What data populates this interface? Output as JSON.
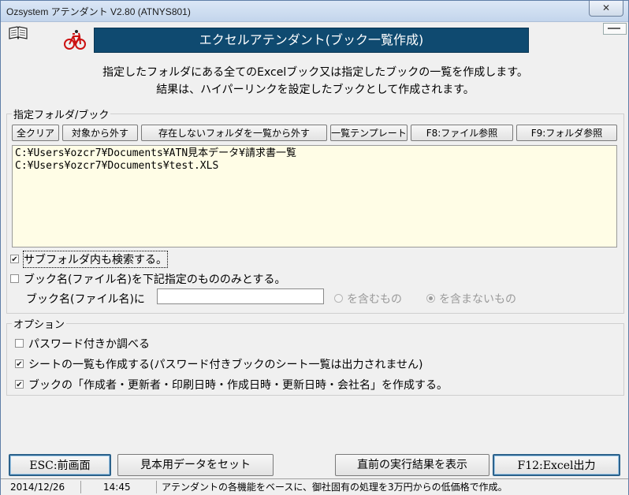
{
  "window": {
    "title": "Ozsystem アテンダント V2.80 (ATNYS801)",
    "close_glyph": "✕"
  },
  "header": {
    "banner": "エクセルアテンダント(ブック一覧作成)",
    "desc_line1": "指定したフォルダにある全てのExcelブック又は指定したブックの一覧を作成します。",
    "desc_line2": "結果は、ハイパーリンクを設定したブックとして作成されます。"
  },
  "folder_group": {
    "label": "指定フォルダ/ブック",
    "buttons": {
      "clear_all": "全クリア",
      "exclude": "対象から外す",
      "remove_missing": "存在しないフォルダを一覧から外す",
      "template": "一覧テンプレート",
      "file_ref": "F8:ファイル参照",
      "folder_ref": "F9:フォルダ参照"
    },
    "paths": [
      "C:¥Users¥ozcr7¥Documents¥ATN見本データ¥請求書一覧",
      "C:¥Users¥ozcr7¥Documents¥test.XLS"
    ],
    "subfolder_label": "サブフォルダ内も検索する。",
    "subfolder_checked": true,
    "bookname_only_label": "ブック名(ファイル名)を下記指定のもののみとする。",
    "bookname_only_checked": false,
    "bookname_field_label": "ブック名(ファイル名)に",
    "bookname_value": "",
    "radio_include": "を含むもの",
    "radio_exclude": "を含まないもの",
    "radio_selected": "exclude"
  },
  "options": {
    "label": "オプション",
    "items": [
      {
        "label": "パスワード付きか調べる",
        "checked": false
      },
      {
        "label": "シートの一覧も作成する(パスワード付きブックのシート一覧は出力されません)",
        "checked": true
      },
      {
        "label": "ブックの「作成者・更新者・印刷日時・作成日時・更新日時・会社名」を作成する。",
        "checked": true
      }
    ]
  },
  "footer_buttons": {
    "esc": "ESC:前画面",
    "sample": "見本用データをセット",
    "last_result": "直前の実行結果を表示",
    "excel_out": "F12:Excel出力"
  },
  "status": {
    "date": "2014/12/26",
    "time": "14:45",
    "message": "アテンダントの各機能をベースに、御社固有の処理を3万円からの低価格で作成。"
  },
  "colors": {
    "banner_bg": "#0f4a70",
    "list_bg": "#fffde6",
    "bike": "#cc1111"
  },
  "icons": [
    "book-icon",
    "bicycle-icon",
    "minimize-indicator-icon"
  ]
}
